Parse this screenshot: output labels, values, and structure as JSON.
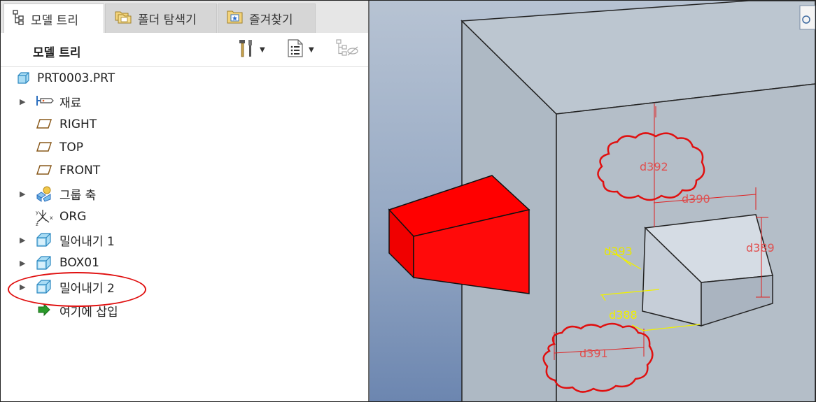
{
  "tabs": [
    {
      "label": "모델 트리",
      "icon": "model-tree-icon",
      "active": true
    },
    {
      "label": "폴더 탐색기",
      "icon": "folder-browser-icon",
      "active": false
    },
    {
      "label": "즐겨찾기",
      "icon": "favorites-icon",
      "active": false
    }
  ],
  "panel": {
    "title": "모델 트리",
    "settings_icon": "tools-icon",
    "show_icon": "list-settings-icon",
    "filter_icon": "tree-filter-icon"
  },
  "tree": {
    "items": [
      {
        "label": "PRT0003.PRT",
        "icon": "part-icon",
        "expandable": false
      },
      {
        "label": "재료",
        "icon": "material-tag-icon",
        "expandable": true
      },
      {
        "label": "RIGHT",
        "icon": "datum-plane-icon",
        "expandable": false
      },
      {
        "label": "TOP",
        "icon": "datum-plane-icon",
        "expandable": false
      },
      {
        "label": "FRONT",
        "icon": "datum-plane-icon",
        "expandable": false
      },
      {
        "label": "그룹 축",
        "icon": "group-icon",
        "expandable": true
      },
      {
        "label": "ORG",
        "icon": "coordinate-system-icon",
        "expandable": false
      },
      {
        "label": "밀어내기 1",
        "icon": "extrude-icon",
        "expandable": true
      },
      {
        "label": "BOX01",
        "icon": "extrude-icon",
        "expandable": true
      },
      {
        "label": "밀어내기 2",
        "icon": "extrude-icon",
        "expandable": true,
        "highlighted": true
      },
      {
        "label": "여기에 삽입",
        "icon": "insert-here-arrow-icon",
        "expandable": false
      }
    ]
  },
  "viewport": {
    "dimensions": [
      "d392",
      "d390",
      "d389",
      "d393",
      "d388",
      "d391"
    ],
    "colors": {
      "background_top": "#aab8cc",
      "background_bottom": "#6c86b0",
      "solid_fill": "#b6c0ca",
      "highlight_feature": "#ff0000",
      "dimension_red": "#e02020",
      "dimension_yellow": "#f0f000",
      "annotation_cloud": "#e01010"
    }
  }
}
